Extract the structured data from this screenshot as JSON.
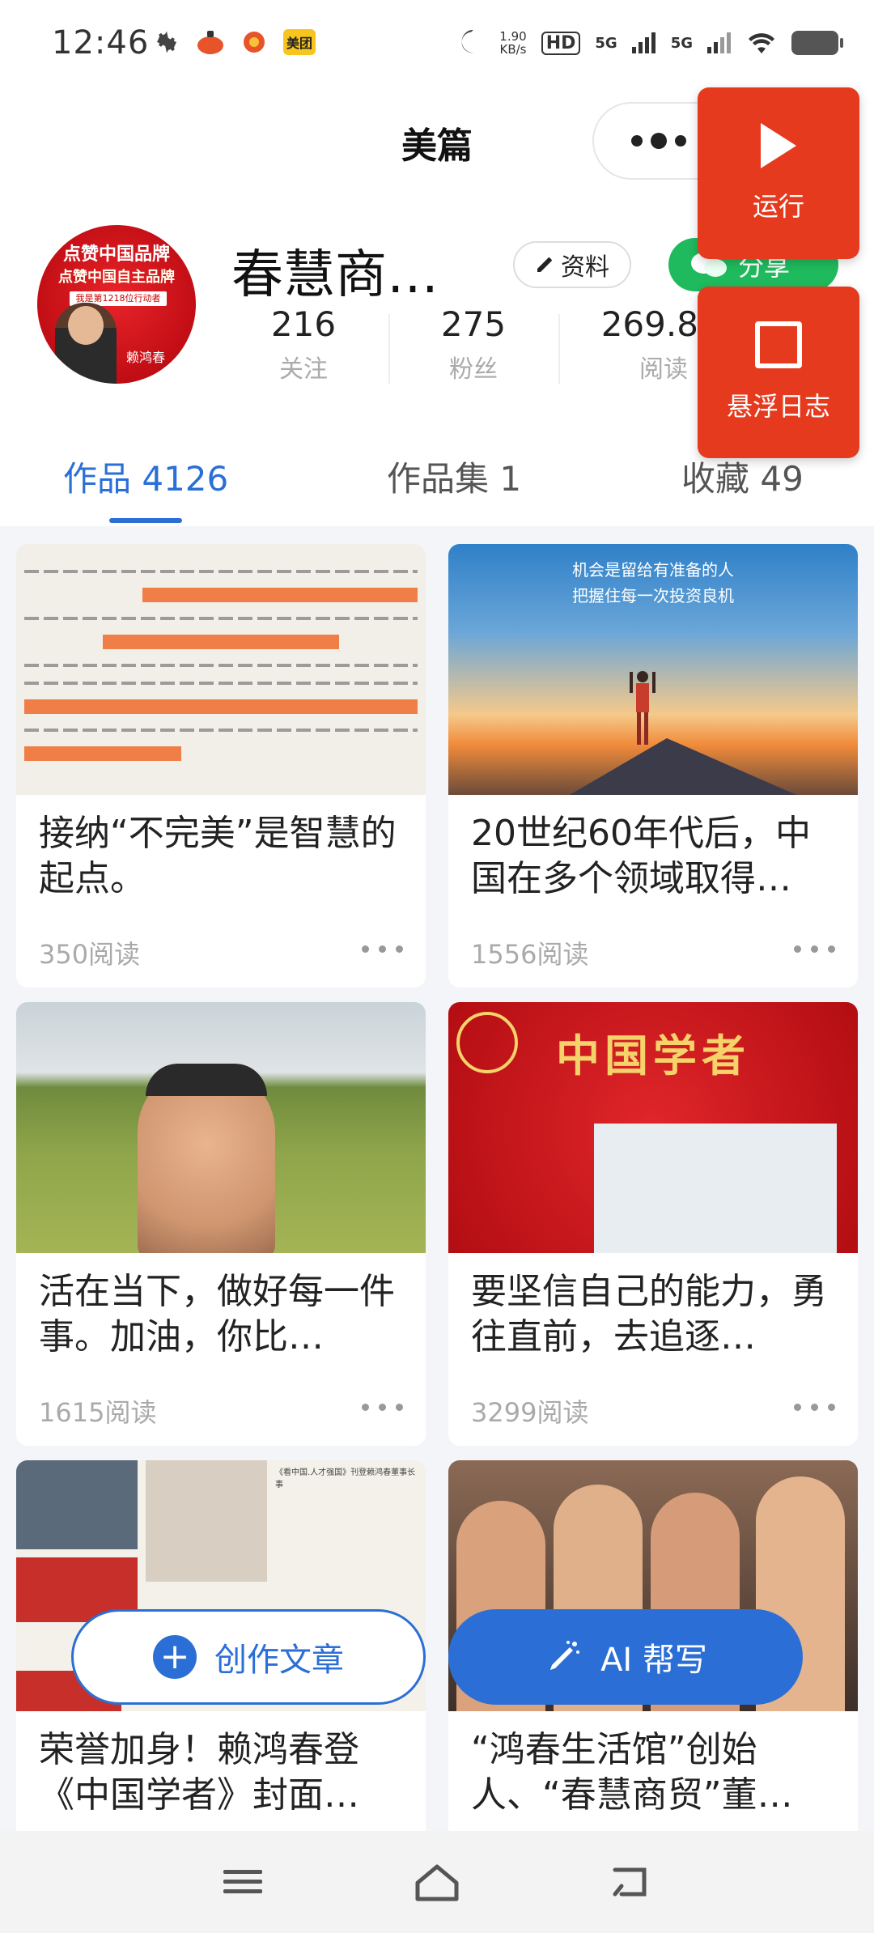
{
  "status_bar": {
    "time": "12:46",
    "net_speed_value": "1.90",
    "net_speed_unit": "KB/s",
    "hd_label": "HD",
    "sig1": "5G",
    "sig2": "5G",
    "meituan_label": "美团"
  },
  "header": {
    "title": "美篇"
  },
  "profile": {
    "name": "春慧商…",
    "info_button": "资料",
    "share_button": "分享",
    "stats": [
      {
        "value": "216",
        "label": "关注"
      },
      {
        "value": "275",
        "label": "粉丝"
      },
      {
        "value": "269.8w",
        "label": "阅读"
      }
    ],
    "avatar": {
      "banner1": "点赞中国品牌",
      "banner2": "点赞中国自主品牌",
      "tagline": "我是第1218位行动者",
      "person_name": "赖鸿春"
    }
  },
  "tabs": [
    {
      "label": "作品 4126",
      "active": true
    },
    {
      "label": "作品集 1",
      "active": false
    },
    {
      "label": "收藏 49",
      "active": false
    }
  ],
  "floating": {
    "run_label": "运行",
    "log_label": "悬浮日志"
  },
  "cards": [
    {
      "title": "接纳“不完美”是智慧的起点。",
      "reads": "350阅读",
      "thumb": "document"
    },
    {
      "title": "20世纪60年代后，中国在多个领域取得…",
      "reads": "1556阅读",
      "thumb": "sunset",
      "caption1": "机会是留给有准备的人",
      "caption2": "把握住每一次投资良机"
    },
    {
      "title": "活在当下，做好每一件事。加油，你比…",
      "reads": "1615阅读",
      "thumb": "field"
    },
    {
      "title": "要坚信自己的能力，勇往直前，去追逐…",
      "reads": "3299阅读",
      "thumb": "red",
      "caption1": "中国学者"
    },
    {
      "title": "荣誉加身！赖鸿春登《中国学者》封面…",
      "reads": "",
      "thumb": "collage",
      "caption1": "《看中国.人才强国》刊登赖鸿春董事长事"
    },
    {
      "title": "“鸿春生活馆”创始人、“春慧商贸”董…",
      "reads": "",
      "thumb": "people"
    }
  ],
  "actions": {
    "create_label": "创作文章",
    "ai_label": "AI 帮写"
  },
  "colors": {
    "accent": "#2b6fd6",
    "float_red": "#e53a1e",
    "share_green": "#1fba5d"
  }
}
